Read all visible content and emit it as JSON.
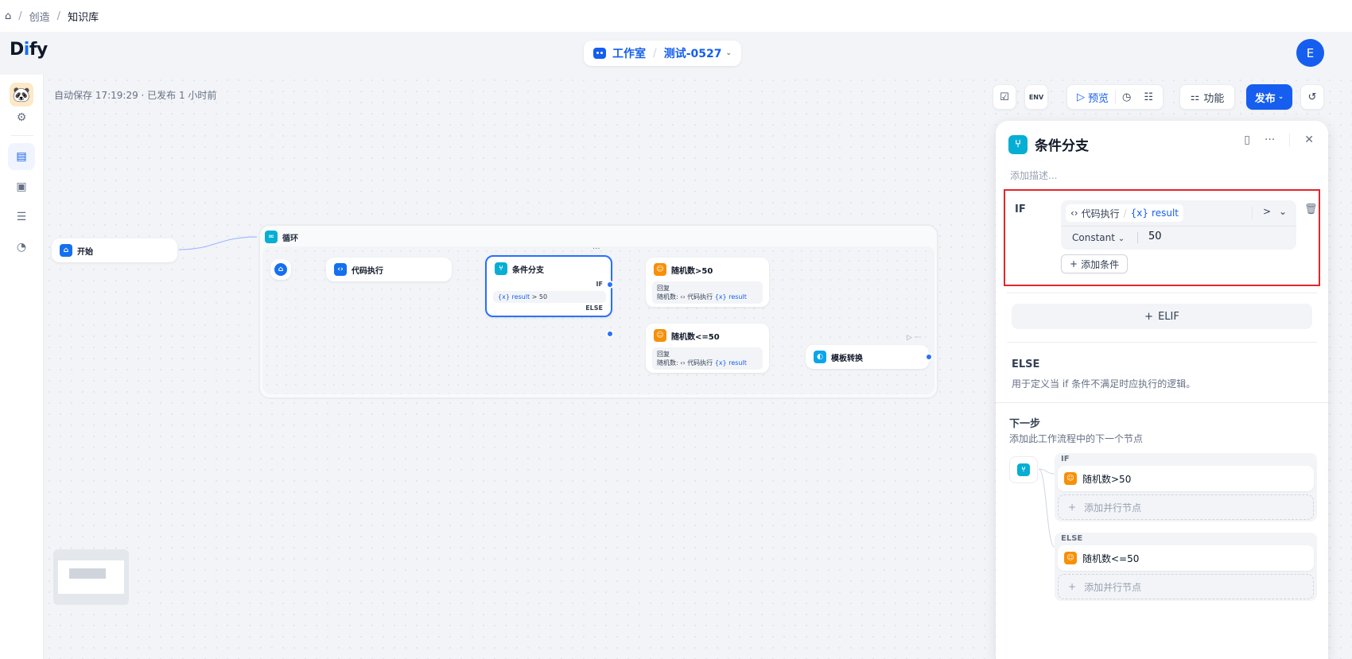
{
  "breadcrumb": {
    "items": [
      "创造",
      "知识库"
    ],
    "separator": "/"
  },
  "header": {
    "logo": "Dify",
    "workspace": "工作室",
    "app_name": "测试-0527",
    "avatar_initial": "E"
  },
  "canvas": {
    "autosave": "自动保存 17:19:29 · 已发布 1 小时前"
  },
  "toolbar": {
    "env": "ENV",
    "preview": "预览",
    "features": "功能",
    "publish": "发布"
  },
  "flow": {
    "start": "开始",
    "loop": "循环",
    "code": "代码执行",
    "ifelse": "条件分支",
    "ifelse_if": "IF",
    "ifelse_else": "ELSE",
    "ifelse_cond_var": "result",
    "ifelse_cond": "> 50",
    "rand_gt": "随机数>50",
    "rand_le": "随机数<=50",
    "answer_label": "回复",
    "answer_prefix": "随机数:",
    "answer_src": "代码执行",
    "answer_var": "result",
    "template": "模板转换"
  },
  "panel": {
    "title": "条件分支",
    "desc_placeholder": "添加描述...",
    "if_label": "IF",
    "cond_node": "代码执行",
    "cond_var": "result",
    "cond_op": ">",
    "const_type": "Constant",
    "const_value": "50",
    "add_condition": "添加条件",
    "elif": "ELIF",
    "else_title": "ELSE",
    "else_desc": "用于定义当 if 条件不满足时应执行的逻辑。",
    "next_title": "下一步",
    "next_desc": "添加此工作流程中的下一个节点",
    "branches": [
      {
        "label": "IF",
        "node": "随机数>50",
        "add_parallel": "添加并行节点"
      },
      {
        "label": "ELSE",
        "node": "随机数<=50",
        "add_parallel": "添加并行节点"
      }
    ]
  },
  "colors": {
    "accent": "#155eef",
    "highlight": "#e5252a",
    "node_orange": "#f79009",
    "node_cyan": "#06aed4"
  }
}
